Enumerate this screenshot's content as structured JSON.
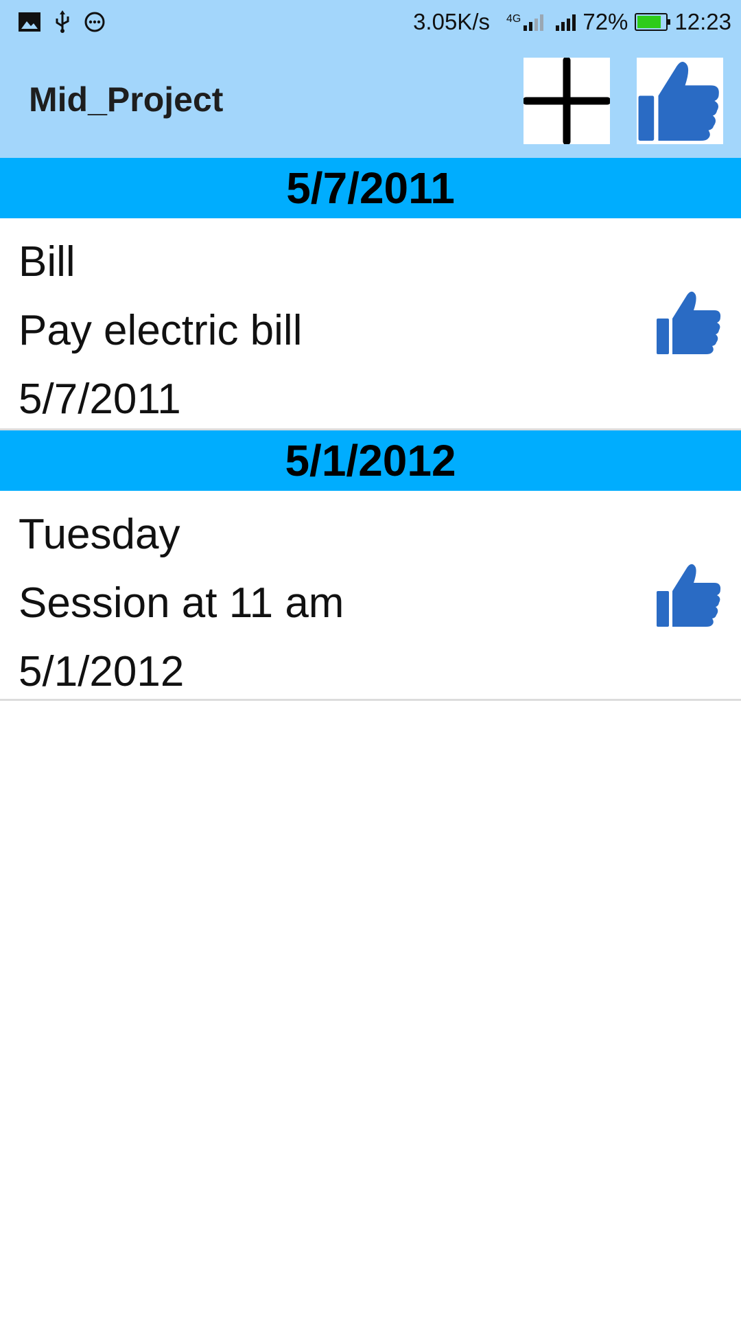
{
  "status_bar": {
    "left_icons": [
      "image-icon",
      "usb-icon",
      "chat-icon"
    ],
    "net_speed": "3.05K/s",
    "network_type": "4G",
    "battery_percent": "72%",
    "time": "12:23"
  },
  "app_bar": {
    "title": "Mid_Project",
    "actions": [
      {
        "icon": "plus-icon",
        "label": "Add"
      },
      {
        "icon": "thumbs-up-icon",
        "label": "Like"
      }
    ]
  },
  "groups": [
    {
      "date_header": "5/7/2011",
      "items": [
        {
          "title": "Bill",
          "description": "Pay electric bill",
          "date": "5/7/2011",
          "icon": "thumbs-up-icon"
        }
      ]
    },
    {
      "date_header": "5/1/2012",
      "items": [
        {
          "title": "Tuesday",
          "description": "Session at 11 am",
          "date": "5/1/2012",
          "icon": "thumbs-up-icon"
        }
      ]
    }
  ],
  "colors": {
    "app_bar": "#a3d6fb",
    "date_header": "#00adfe",
    "accent_icon": "#2a6bc4",
    "battery": "#2ecc1a"
  }
}
